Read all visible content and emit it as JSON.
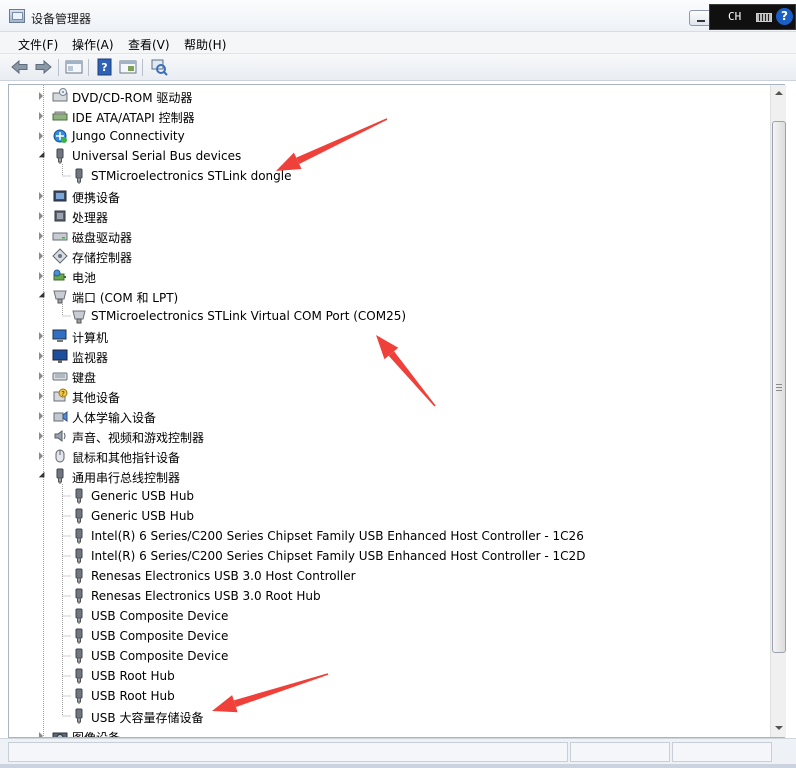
{
  "window": {
    "title": "设备管理器"
  },
  "language_bar": {
    "lang": "CH",
    "help_symbol": "?"
  },
  "menu": {
    "file": "文件(F)",
    "action": "操作(A)",
    "view": "查看(V)",
    "help": "帮助(H)"
  },
  "tree": {
    "rows": [
      {
        "label": "DVD/CD-ROM 驱动器",
        "icon": "dvd-drive-icon",
        "state": "collapsed",
        "level": 0
      },
      {
        "label": "IDE ATA/ATAPI 控制器",
        "icon": "ide-controller-icon",
        "state": "collapsed",
        "level": 0
      },
      {
        "label": "Jungo Connectivity",
        "icon": "jungo-icon",
        "state": "collapsed",
        "level": 0
      },
      {
        "label": "Universal Serial Bus devices",
        "icon": "usb-device-icon",
        "state": "expanded",
        "level": 0
      },
      {
        "label": "STMicroelectronics STLink dongle",
        "icon": "usb-device-icon",
        "state": "leaf",
        "level": 1
      },
      {
        "label": "便携设备",
        "icon": "portable-device-icon",
        "state": "collapsed",
        "level": 0
      },
      {
        "label": "处理器",
        "icon": "processor-icon",
        "state": "collapsed",
        "level": 0
      },
      {
        "label": "磁盘驱动器",
        "icon": "disk-drive-icon",
        "state": "collapsed",
        "level": 0
      },
      {
        "label": "存储控制器",
        "icon": "storage-controller-icon",
        "state": "collapsed",
        "level": 0
      },
      {
        "label": "电池",
        "icon": "battery-icon",
        "state": "collapsed",
        "level": 0
      },
      {
        "label": "端口 (COM 和 LPT)",
        "icon": "port-icon",
        "state": "expanded",
        "level": 0
      },
      {
        "label": "STMicroelectronics STLink Virtual COM Port (COM25)",
        "icon": "port-icon",
        "state": "leaf",
        "level": 1
      },
      {
        "label": "计算机",
        "icon": "computer-icon",
        "state": "collapsed",
        "level": 0
      },
      {
        "label": "监视器",
        "icon": "monitor-icon",
        "state": "collapsed",
        "level": 0
      },
      {
        "label": "键盘",
        "icon": "keyboard-icon",
        "state": "collapsed",
        "level": 0
      },
      {
        "label": "其他设备",
        "icon": "other-devices-icon",
        "state": "collapsed",
        "level": 0
      },
      {
        "label": "人体学输入设备",
        "icon": "hid-icon",
        "state": "collapsed",
        "level": 0
      },
      {
        "label": "声音、视频和游戏控制器",
        "icon": "speaker-icon",
        "state": "collapsed",
        "level": 0
      },
      {
        "label": "鼠标和其他指针设备",
        "icon": "mouse-icon",
        "state": "collapsed",
        "level": 0
      },
      {
        "label": "通用串行总线控制器",
        "icon": "usb-device-icon",
        "state": "expanded",
        "level": 0
      },
      {
        "label": "Generic USB Hub",
        "icon": "usb-device-icon",
        "state": "leaf",
        "level": 1
      },
      {
        "label": "Generic USB Hub",
        "icon": "usb-device-icon",
        "state": "leaf",
        "level": 1
      },
      {
        "label": "Intel(R) 6 Series/C200 Series Chipset Family USB Enhanced Host Controller - 1C26",
        "icon": "usb-device-icon",
        "state": "leaf",
        "level": 1
      },
      {
        "label": "Intel(R) 6 Series/C200 Series Chipset Family USB Enhanced Host Controller - 1C2D",
        "icon": "usb-device-icon",
        "state": "leaf",
        "level": 1
      },
      {
        "label": "Renesas Electronics USB 3.0 Host Controller",
        "icon": "usb-device-icon",
        "state": "leaf",
        "level": 1
      },
      {
        "label": "Renesas Electronics USB 3.0 Root Hub",
        "icon": "usb-device-icon",
        "state": "leaf",
        "level": 1
      },
      {
        "label": "USB Composite Device",
        "icon": "usb-device-icon",
        "state": "leaf",
        "level": 1
      },
      {
        "label": "USB Composite Device",
        "icon": "usb-device-icon",
        "state": "leaf",
        "level": 1
      },
      {
        "label": "USB Composite Device",
        "icon": "usb-device-icon",
        "state": "leaf",
        "level": 1
      },
      {
        "label": "USB Root Hub",
        "icon": "usb-device-icon",
        "state": "leaf",
        "level": 1
      },
      {
        "label": "USB Root Hub",
        "icon": "usb-device-icon",
        "state": "leaf",
        "level": 1
      },
      {
        "label": "USB 大容量存储设备",
        "icon": "usb-device-icon",
        "state": "leaf",
        "level": 1
      },
      {
        "label": "图像设备",
        "icon": "imaging-device-icon",
        "state": "collapsed",
        "level": 0
      }
    ]
  },
  "colors": {
    "annotation_arrow": "#f0403a",
    "tree_line": "#a0a0a0"
  }
}
